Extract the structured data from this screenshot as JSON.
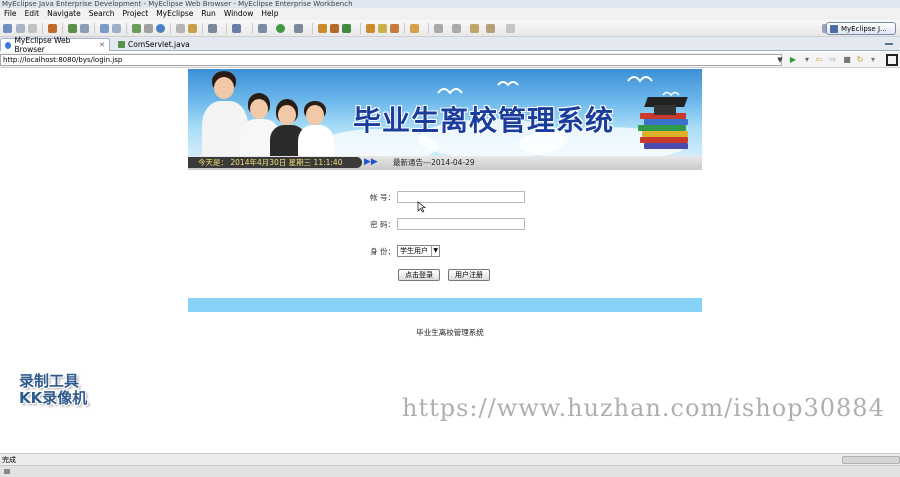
{
  "window": {
    "title": "MyEclipse Java Enterprise Development - MyEclipse Web Browser - MyEclipse Enterprise Workbench"
  },
  "menu": [
    "File",
    "Edit",
    "Navigate",
    "Search",
    "Project",
    "MyEclipse",
    "Run",
    "Window",
    "Help"
  ],
  "toolbar": {
    "perspective_label": "MyEclipse J..."
  },
  "tabs": [
    {
      "label": "MyEclipse Web Browser",
      "active": true
    },
    {
      "label": "ComServlet.java",
      "active": false
    }
  ],
  "address": {
    "url": "http://localhost:8080/bys/login.jsp"
  },
  "page": {
    "banner_title": "毕业生离校管理系统",
    "date_text": "今天是： 2014年4月30日 星期三 11:1:40",
    "notice_text": "最新通告---2014-04-29",
    "form": {
      "account_label": "帐 号：",
      "account_value": "",
      "password_label": "密 码：",
      "password_value": "",
      "role_label": "身 份：",
      "role_selected": "学生用户",
      "login_button": "点击登录",
      "register_button": "用户注册"
    },
    "footer": "毕业生离校管理系统"
  },
  "watermark": {
    "logo_line1": "录制工具",
    "logo_line2": "KK录像机",
    "url": "https://www.huzhan.com/ishop30884"
  },
  "status": {
    "text": "完成"
  },
  "colors": {
    "banner_title": "#1a3d9c",
    "blue_bar": "#86d1f6",
    "date_bar_dark": "#3a3a3a"
  }
}
